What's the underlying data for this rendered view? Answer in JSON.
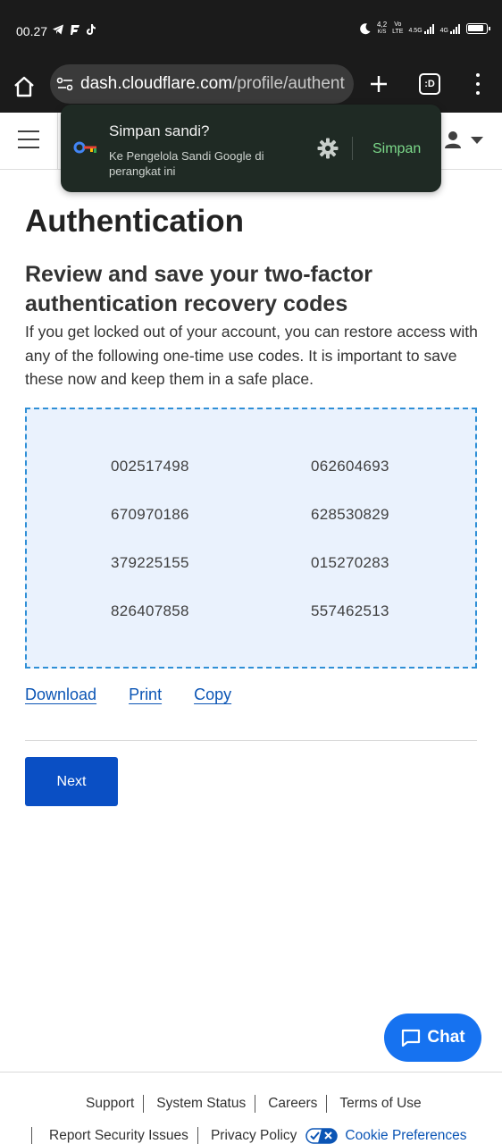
{
  "status_bar": {
    "time": "00.27",
    "left_icons": [
      "telegram-icon",
      "app-icon",
      "tiktok-icon"
    ],
    "speed_value": "4,2",
    "speed_unit": "K/S",
    "network_label_top": "Vo",
    "network_label_bottom": "LTE",
    "signal_1_label": "4.5G",
    "signal_2_label": "4G"
  },
  "browser": {
    "url_host": "dash.cloudflare.com",
    "url_path": "/profile/authent",
    "tabs_label": ":D"
  },
  "password_popup": {
    "title": "Simpan sandi?",
    "subtitle": "Ke Pengelola Sandi Google di perangkat ini",
    "save_label": "Simpan"
  },
  "main": {
    "title": "Authentication",
    "heading": "Review and save your two-factor authentication recovery codes",
    "description": "If you get locked out of your account, you can restore access with any of the following one-time use codes. It is important to save these now and keep them in a safe place.",
    "codes": [
      [
        "002517498",
        "062604693"
      ],
      [
        "670970186",
        "628530829"
      ],
      [
        "379225155",
        "015270283"
      ],
      [
        "826407858",
        "557462513"
      ]
    ],
    "actions": {
      "download": "Download",
      "print": "Print",
      "copy": "Copy"
    },
    "next_label": "Next"
  },
  "chat": {
    "label": "Chat"
  },
  "footer": {
    "row1": [
      "Support",
      "System Status",
      "Careers",
      "Terms of Use"
    ],
    "row2": [
      "Report Security Issues",
      "Privacy Policy",
      "Cookie Preferences"
    ]
  },
  "colors": {
    "accent_blue": "#0a4fc4",
    "link_blue": "#0b55b5",
    "codes_bg": "#eaf2fd",
    "codes_border": "#2f8fd6",
    "popup_bg": "#1f2a24",
    "popup_save": "#7bd889"
  }
}
